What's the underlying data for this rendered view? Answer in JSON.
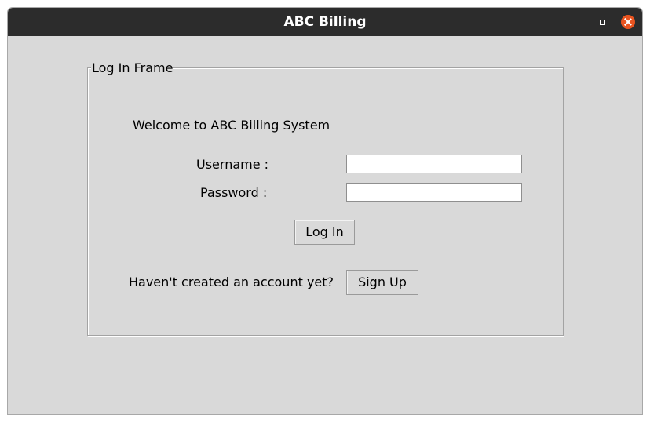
{
  "window": {
    "title": "ABC Billing",
    "controls": [
      "minimize-icon",
      "maximize-icon",
      "close-icon"
    ],
    "close_color": "#e95420"
  },
  "login_frame": {
    "label": "Log In Frame",
    "welcome_text": "Welcome to ABC Billing System",
    "username_label": "Username :",
    "username_value": "",
    "password_label": "Password :",
    "password_value": "",
    "login_button": "Log In",
    "no_account_text": "Haven't created an account yet?",
    "signup_button": "Sign Up"
  }
}
